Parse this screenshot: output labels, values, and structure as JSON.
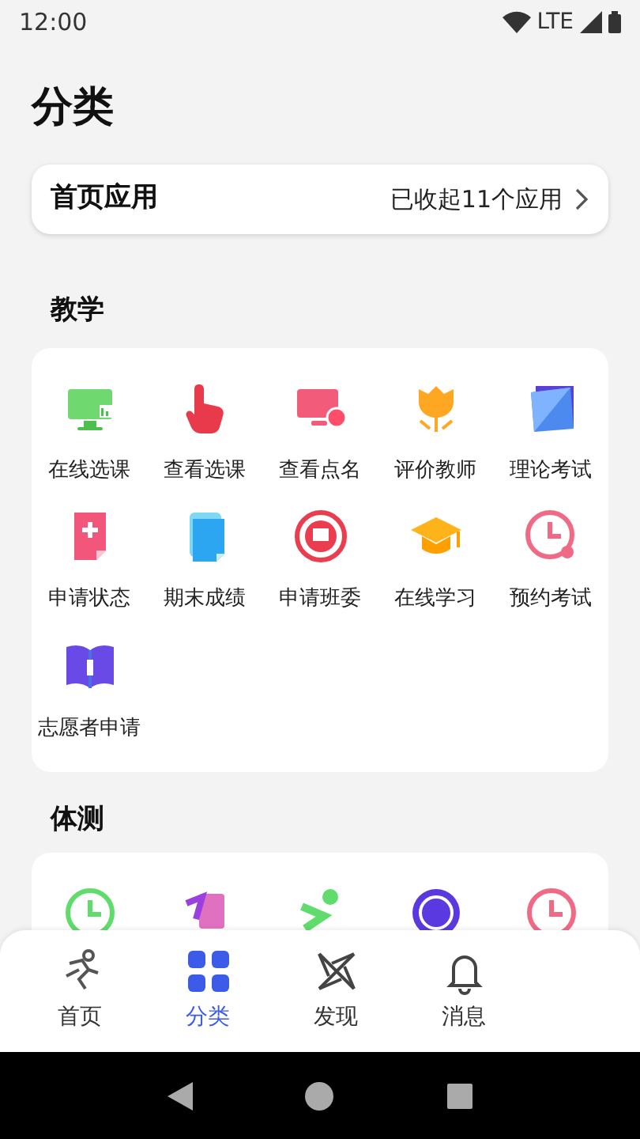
{
  "status_bar": {
    "time": "12:00",
    "network": "LTE"
  },
  "title": "分类",
  "home_apps": {
    "label": "首页应用",
    "value": "已收起11个应用"
  },
  "sections": [
    {
      "title": "教学",
      "items": [
        {
          "label": "在线选课"
        },
        {
          "label": "查看选课"
        },
        {
          "label": "查看点名"
        },
        {
          "label": "评价教师"
        },
        {
          "label": "理论考试"
        },
        {
          "label": "申请状态"
        },
        {
          "label": "期末成绩"
        },
        {
          "label": "申请班委"
        },
        {
          "label": "在线学习"
        },
        {
          "label": "预约考试"
        },
        {
          "label": "志愿者申请"
        }
      ]
    },
    {
      "title": "体测"
    }
  ],
  "tabs": [
    {
      "label": "首页",
      "selected": false
    },
    {
      "label": "分类",
      "selected": true
    },
    {
      "label": "发现",
      "selected": false
    },
    {
      "label": "消息",
      "selected": false
    }
  ]
}
